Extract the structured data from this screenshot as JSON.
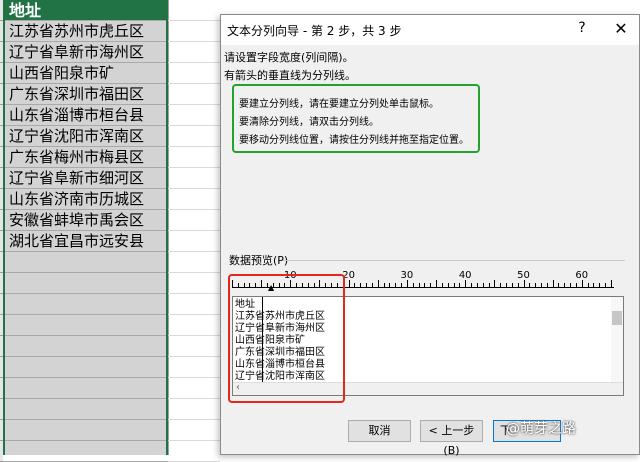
{
  "sheet": {
    "header": "地址",
    "rows": [
      "江苏省苏州市虎丘区",
      "辽宁省阜新市海州区",
      "山西省阳泉市矿",
      "广东省深圳市福田区",
      "山东省淄博市桓台县",
      "辽宁省沈阳市浑南区",
      "广东省梅州市梅县区",
      "辽宁省阜新市细河区",
      "山东省济南市历城区",
      "安徽省蚌埠市禹会区",
      "湖北省宜昌市远安县"
    ]
  },
  "dialog": {
    "title": "文本分列向导 - 第 2 步，共 3 步",
    "help": "?",
    "close": "✕",
    "instruction1": "请设置字段宽度(列间隔)。",
    "instruction2": "有箭头的垂直线为分列线。",
    "info": [
      "要建立分列线，请在要建立分列处单击鼠标。",
      "要清除分列线，请双击分列线。",
      "要移动分列线位置，请按住分列线并拖至指定位置。"
    ],
    "preview_label": "数据预览(P)",
    "ruler_numbers": [
      "10",
      "20",
      "30",
      "40",
      "50",
      "60"
    ],
    "preview_lines": [
      "地址",
      "江苏省苏州市虎丘区",
      "辽宁省阜新市海州区",
      "山西省阳泉市矿",
      "广东省深圳市福田区",
      "山东省淄博市桓台县",
      "辽宁省沈阳市浑南区"
    ],
    "buttons": {
      "cancel": "取消",
      "back": "< 上一步(B)",
      "next": "下"
    }
  },
  "watermark": "@萌芽之路",
  "colors": {
    "excel_green": "#217346",
    "highlight_green": "#22a330",
    "highlight_red": "#e3271e",
    "selection_gray": "#d3d3d3"
  }
}
